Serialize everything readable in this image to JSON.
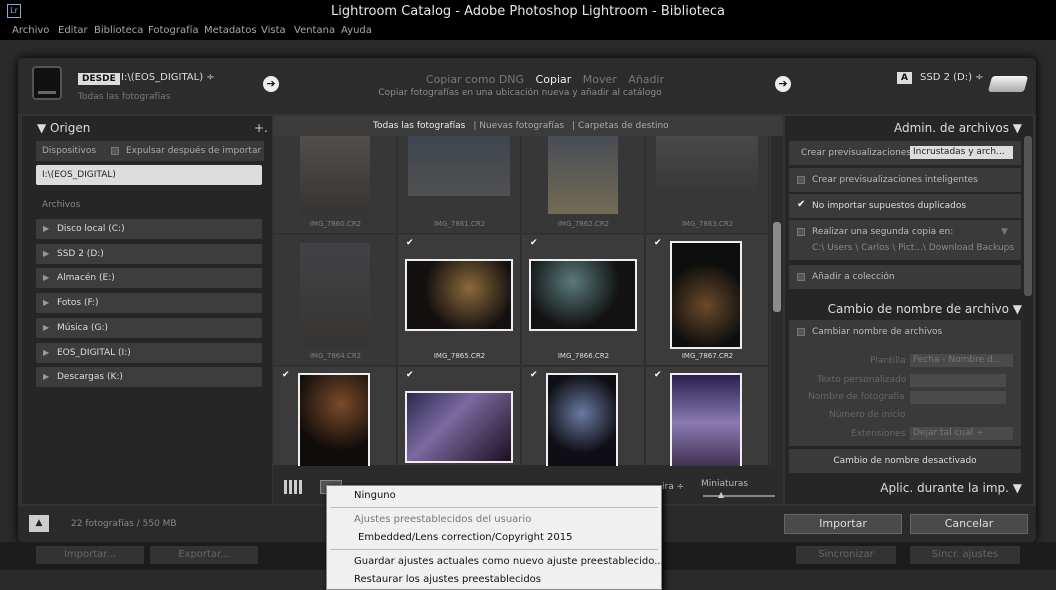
{
  "app": {
    "title": "Lightroom Catalog - Adobe Photoshop Lightroom - Biblioteca",
    "logo": "Lr"
  },
  "menu": [
    "Archivo",
    "Editar",
    "Biblioteca",
    "Fotografía",
    "Metadatos",
    "Vista",
    "Ventana",
    "Ayuda"
  ],
  "header": {
    "from_badge": "DESDE",
    "source_path": "I:\\(EOS_DIGITAL) ÷",
    "source_sub": "Todas las fotografías",
    "modes": [
      "Copiar como DNG",
      "Copiar",
      "Mover",
      "Añadir"
    ],
    "active_mode": "Copiar",
    "mode_desc": "Copiar fotografías en una ubicación nueva y añadir al catálogo",
    "to_badge": "A",
    "dest_path": "SSD 2 (D:) ÷"
  },
  "source_panel": {
    "title": "Origen",
    "plus": "+.",
    "devices_label": "Dispositivos",
    "eject_label": "Expulsar después de importar",
    "device": "I:\\(EOS_DIGITAL)",
    "files_label": "Archivos",
    "volumes": [
      "Disco local (C:)",
      "SSD 2 (D:)",
      "Almacén (E:)",
      "Fotos (F:)",
      "Música (G:)",
      "EOS_DIGITAL (I:)",
      "Descargas (K:)"
    ]
  },
  "tabs": [
    "Todas las fotografías",
    "Nuevas fotografías",
    "Carpetas de destino"
  ],
  "photos": [
    {
      "name": "IMG_7860.CR2",
      "checked": false,
      "dim": true
    },
    {
      "name": "IMG_7861.CR2",
      "checked": false,
      "dim": true
    },
    {
      "name": "IMG_7862.CR2",
      "checked": false,
      "dim": true
    },
    {
      "name": "IMG_7863.CR2",
      "checked": false,
      "dim": true
    },
    {
      "name": "IMG_7864.CR2",
      "checked": false,
      "dim": true
    },
    {
      "name": "IMG_7865.CR2",
      "checked": true,
      "dim": false
    },
    {
      "name": "IMG_7866.CR2",
      "checked": true,
      "dim": false
    },
    {
      "name": "IMG_7867.CR2",
      "checked": true,
      "dim": false
    },
    {
      "name": "",
      "checked": true,
      "dim": false
    },
    {
      "name": "",
      "checked": true,
      "dim": false
    },
    {
      "name": "",
      "checked": true,
      "dim": false
    },
    {
      "name": "",
      "checked": true,
      "dim": false
    }
  ],
  "toolbar": {
    "sort_label": "ira ÷",
    "thumb_label": "Miniaturas"
  },
  "file_panel": {
    "title": "Admin. de archivos",
    "previews_label": "Crear previsualizaciones",
    "previews_value": "Incrustadas y arch... ÷",
    "smart_previews": "Crear previsualizaciones inteligentes",
    "no_duplicates": "No importar supuestos duplicados",
    "second_copy": "Realizar una segunda copia en:",
    "second_copy_path": "C:\\ Users \\ Carlos \\ Pict...\\ Download Backups",
    "add_collection": "Añadir a colección"
  },
  "rename_panel": {
    "title": "Cambio de nombre de archivo",
    "rename_files": "Cambiar nombre de archivos",
    "template_label": "Plantilla",
    "template_value": "Fecha - Nombre d... ÷",
    "custom_text": "Texto personalizado",
    "photo_name": "Nombre de fotografía",
    "start_number": "Número de inicio",
    "extensions_label": "Extensiones",
    "extensions_value": "Dejar tal cual ÷",
    "status": "Cambio de nombre desactivado"
  },
  "apply_panel": {
    "title": "Aplic. durante la imp."
  },
  "bottom": {
    "count": "22 fotografías / 550 MB",
    "import": "Importar",
    "cancel": "Cancelar",
    "up_icon": "▲"
  },
  "background_bar": {
    "import": "Importar...",
    "export": "Exportar...",
    "sync1": "Sincronizar",
    "sync2": "Sincr. ajustes"
  },
  "dropdown": {
    "none": "Ninguno",
    "user_presets": "Ajustes preestablecidos del usuario",
    "preset1": "Embedded/Lens correction/Copyright 2015",
    "save": "Guardar ajustes actuales como nuevo ajuste preestablecido...",
    "restore": "Restaurar los ajustes preestablecidos"
  }
}
